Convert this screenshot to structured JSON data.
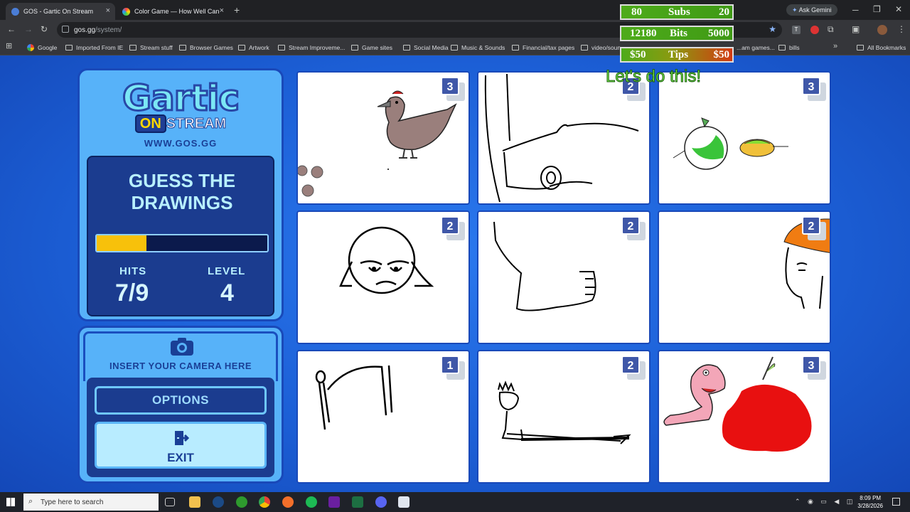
{
  "browser": {
    "tabs": [
      {
        "label": "GOS - Gartic On Stream",
        "active": true
      },
      {
        "label": "Color Game — How Well Can You See"
      }
    ],
    "new_tab": "+",
    "url_host": "gos.gg",
    "url_path": "/system/",
    "ask_gemini": "Ask Gemini",
    "bookmarks": [
      "Google",
      "Imported From IE",
      "Stream stuff",
      "Browser Games",
      "Artwork",
      "Stream Improveme...",
      "Game sites",
      "Social Media",
      "Music & Sounds",
      "Financial/tax pages",
      "video/soun...",
      "...am games...",
      "bills"
    ],
    "all_bookmarks": "All Bookmarks"
  },
  "overlay": {
    "subs": {
      "left": "80",
      "mid": "Subs",
      "right": "20"
    },
    "bits": {
      "left": "12180",
      "mid": "Bits",
      "right": "5000"
    },
    "tips": {
      "left": "$50",
      "mid": "Tips",
      "right": "$50"
    },
    "message": "Let's do this!"
  },
  "game": {
    "logo_main": "Gartic",
    "logo_on": "ON",
    "logo_stream": "STREAM",
    "site": "WWW.GOS.GG",
    "title_line1": "GUESS THE",
    "title_line2": "DRAWINGS",
    "progress_fraction": 0.29,
    "hits_label": "HITS",
    "hits_value": "7/9",
    "level_label": "LEVEL",
    "level_value": "4",
    "camera_text": "INSERT YOUR CAMERA HERE",
    "options_label": "OPTIONS",
    "exit_label": "EXIT",
    "cards": [
      "3",
      "2",
      "3",
      "2",
      "2",
      "2",
      "1",
      "2",
      "3"
    ]
  },
  "taskbar": {
    "search_placeholder": "Type here to search",
    "time": "8:09 PM",
    "date": "3/28/2026"
  }
}
